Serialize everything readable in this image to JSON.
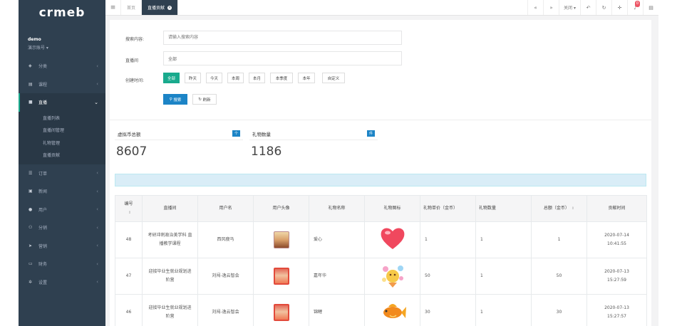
{
  "sidebar": {
    "logo": "crmeb",
    "user_name": "demo",
    "user_role": "演示账号 ▾",
    "items": [
      {
        "label": "分类",
        "icon": "tags-icon"
      },
      {
        "label": "课程",
        "icon": "book-icon"
      },
      {
        "label": "直播",
        "icon": "video-icon",
        "active": true
      },
      {
        "label": "订单",
        "icon": "list-icon"
      },
      {
        "label": "新闻",
        "icon": "image-icon"
      },
      {
        "label": "用户",
        "icon": "user-icon"
      },
      {
        "label": "分销",
        "icon": "users-icon"
      },
      {
        "label": "营销",
        "icon": "send-icon"
      },
      {
        "label": "财务",
        "icon": "money-icon"
      },
      {
        "label": "设置",
        "icon": "gear-icon"
      }
    ],
    "sub_items": [
      "直播列表",
      "直播间管理",
      "礼物管理",
      "直播贡献"
    ]
  },
  "topbar": {
    "tabs": [
      {
        "label": "首页"
      },
      {
        "label": "直播贡献",
        "active": true
      }
    ],
    "close_label": "关闭 ▾",
    "badge": "0"
  },
  "filters": {
    "search_label": "搜索内容:",
    "search_placeholder": "请输入搜索内容",
    "room_label": "直播间",
    "room_value": "全部",
    "time_label": "创建时间:",
    "time_options": [
      "全部",
      "昨天",
      "今天",
      "本周",
      "本月",
      "本季度",
      "本年",
      "自定义"
    ],
    "search_button": "搜索",
    "refresh_button": "刷新"
  },
  "stats": [
    {
      "title": "虚拟币总额",
      "tag": "个",
      "value": "8607"
    },
    {
      "title": "礼物数量",
      "tag": "件",
      "value": "1186"
    }
  ],
  "table": {
    "headers": [
      "编号",
      "直播间",
      "用户名",
      "用户头像",
      "礼物名称",
      "礼物图标",
      "礼物单价（金币）",
      "礼物数量",
      "总额（金币）",
      "贡献时间"
    ],
    "rows": [
      {
        "id": "48",
        "room": "考研冲刺政治美学科 直播教学课程",
        "user": "西风瘦马",
        "gift": "爱心",
        "price": "1",
        "qty": "1",
        "total": "1",
        "date": "2020-07-14",
        "time": "10:41:55"
      },
      {
        "id": "47",
        "room": "迎接毕业生就业规划进阶营",
        "user": "刘闯-逸云智会",
        "gift": "嘉年华",
        "price": "50",
        "qty": "1",
        "total": "50",
        "date": "2020-07-13",
        "time": "15:27:59"
      },
      {
        "id": "46",
        "room": "迎接毕业生就业规划进阶营",
        "user": "刘闯-逸云智会",
        "gift": "锦鲤",
        "price": "30",
        "qty": "1",
        "total": "30",
        "date": "2020-07-13",
        "time": "15:27:57"
      }
    ]
  },
  "colors": {
    "sidebar": "#2f4050",
    "accent": "#19aa8d",
    "primary": "#1c84c6",
    "info": "#d9edf7"
  }
}
